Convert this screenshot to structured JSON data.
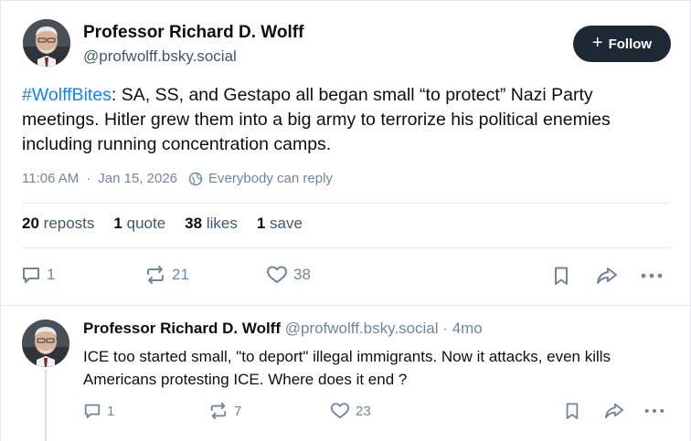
{
  "post": {
    "author_name": "Professor Richard D. Wolff",
    "author_handle": "@profwolff.bsky.social",
    "follow_label": "Follow",
    "hashtag": "#WolffBites",
    "text": ": SA, SS, and Gestapo all began small “to protect” Nazi Party meetings. Hitler grew them into a big army to terrorize his political enemies including running concentration camps.",
    "timestamp": "11:06 AM",
    "date": "Jan 15, 2026",
    "reply_setting": "Everybody can reply",
    "stats": {
      "reposts_num": "20",
      "reposts_label": "reposts",
      "quotes_num": "1",
      "quotes_label": "quote",
      "likes_num": "38",
      "likes_label": "likes",
      "saves_num": "1",
      "saves_label": "save"
    },
    "actions": {
      "replies": "1",
      "reposts": "21",
      "likes": "38"
    }
  },
  "reply": {
    "author_name": "Professor Richard D. Wolff",
    "author_handle": "@profwolff.bsky.social",
    "separator": "·",
    "age": "4mo",
    "text": "ICE too started small, \"to deport\" illegal immigrants. Now it attacks, even kills Americans protesting ICE. Where does it end ?",
    "actions": {
      "replies": "1",
      "reposts": "7",
      "likes": "23"
    }
  },
  "meta_separator": "·",
  "colors": {
    "accent": "#1083fe",
    "follow_bg": "#1e2935",
    "muted": "#6f869f",
    "border": "#e3e8ee"
  },
  "icons": [
    "reply-icon",
    "repost-icon",
    "like-icon",
    "bookmark-icon",
    "share-icon",
    "more-icon",
    "globe-icon",
    "plus-icon"
  ]
}
